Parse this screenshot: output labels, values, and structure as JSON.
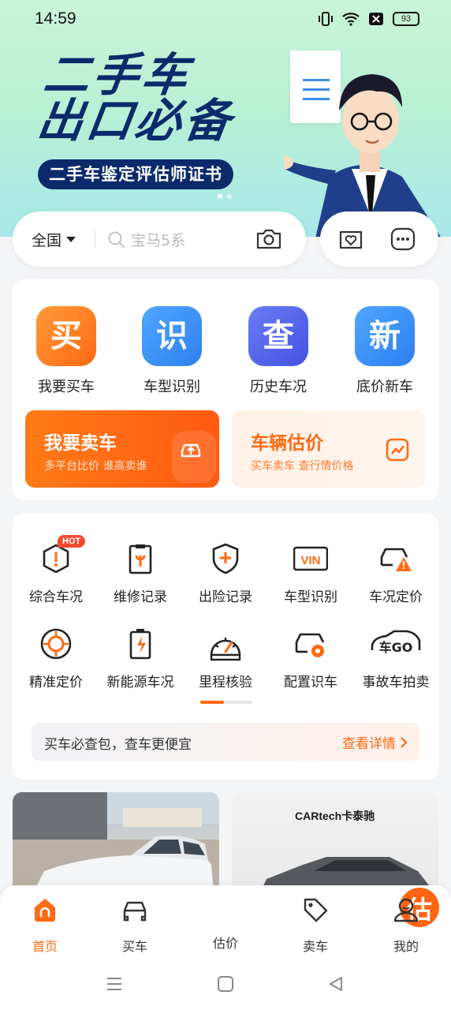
{
  "status_bar": {
    "time": "14:59",
    "battery": "93"
  },
  "hero": {
    "title_line1": "二手车",
    "title_line2": "出口必备",
    "subtitle": "二手车鉴定评估师证书"
  },
  "search": {
    "region": "全国",
    "placeholder": "宝马5系"
  },
  "quick_actions": [
    {
      "glyph": "买",
      "label": "我要买车",
      "color": "#ff7f1f"
    },
    {
      "glyph": "识",
      "label": "车型识别",
      "color": "#2f8bf0"
    },
    {
      "glyph": "查",
      "label": "历史车况",
      "color": "#4b5ee8"
    },
    {
      "glyph": "新",
      "label": "底价新车",
      "color": "#2f8bf0"
    }
  ],
  "sell_card": {
    "title": "我要卖车",
    "subtitle": "多平台比价 谁高卖谁"
  },
  "estimate_card": {
    "title": "车辆估价",
    "subtitle": "买车卖车 查行情价格"
  },
  "tools": [
    {
      "label": "综合车况",
      "badge": "HOT"
    },
    {
      "label": "维修记录"
    },
    {
      "label": "出险记录"
    },
    {
      "label": "车型识别",
      "icon_text": "VIN"
    },
    {
      "label": "车况定价"
    },
    {
      "label": "精准定价"
    },
    {
      "label": "新能源车况"
    },
    {
      "label": "里程核验"
    },
    {
      "label": "配置识车"
    },
    {
      "label": "事故车拍卖",
      "icon_text": "车GO"
    }
  ],
  "tools_scroll_progress": 0.45,
  "promo_banner": {
    "text": "买车必查包，查车更便宜",
    "link": "查看详情"
  },
  "feed": {
    "brand": "CARtech卡泰驰"
  },
  "bottom_nav": {
    "items": [
      "首页",
      "买车",
      "估价",
      "卖车",
      "我的"
    ],
    "fab_glyph": "估",
    "active": "首页"
  },
  "colors": {
    "accent": "#ff6a12",
    "navy": "#0b2a6b"
  }
}
